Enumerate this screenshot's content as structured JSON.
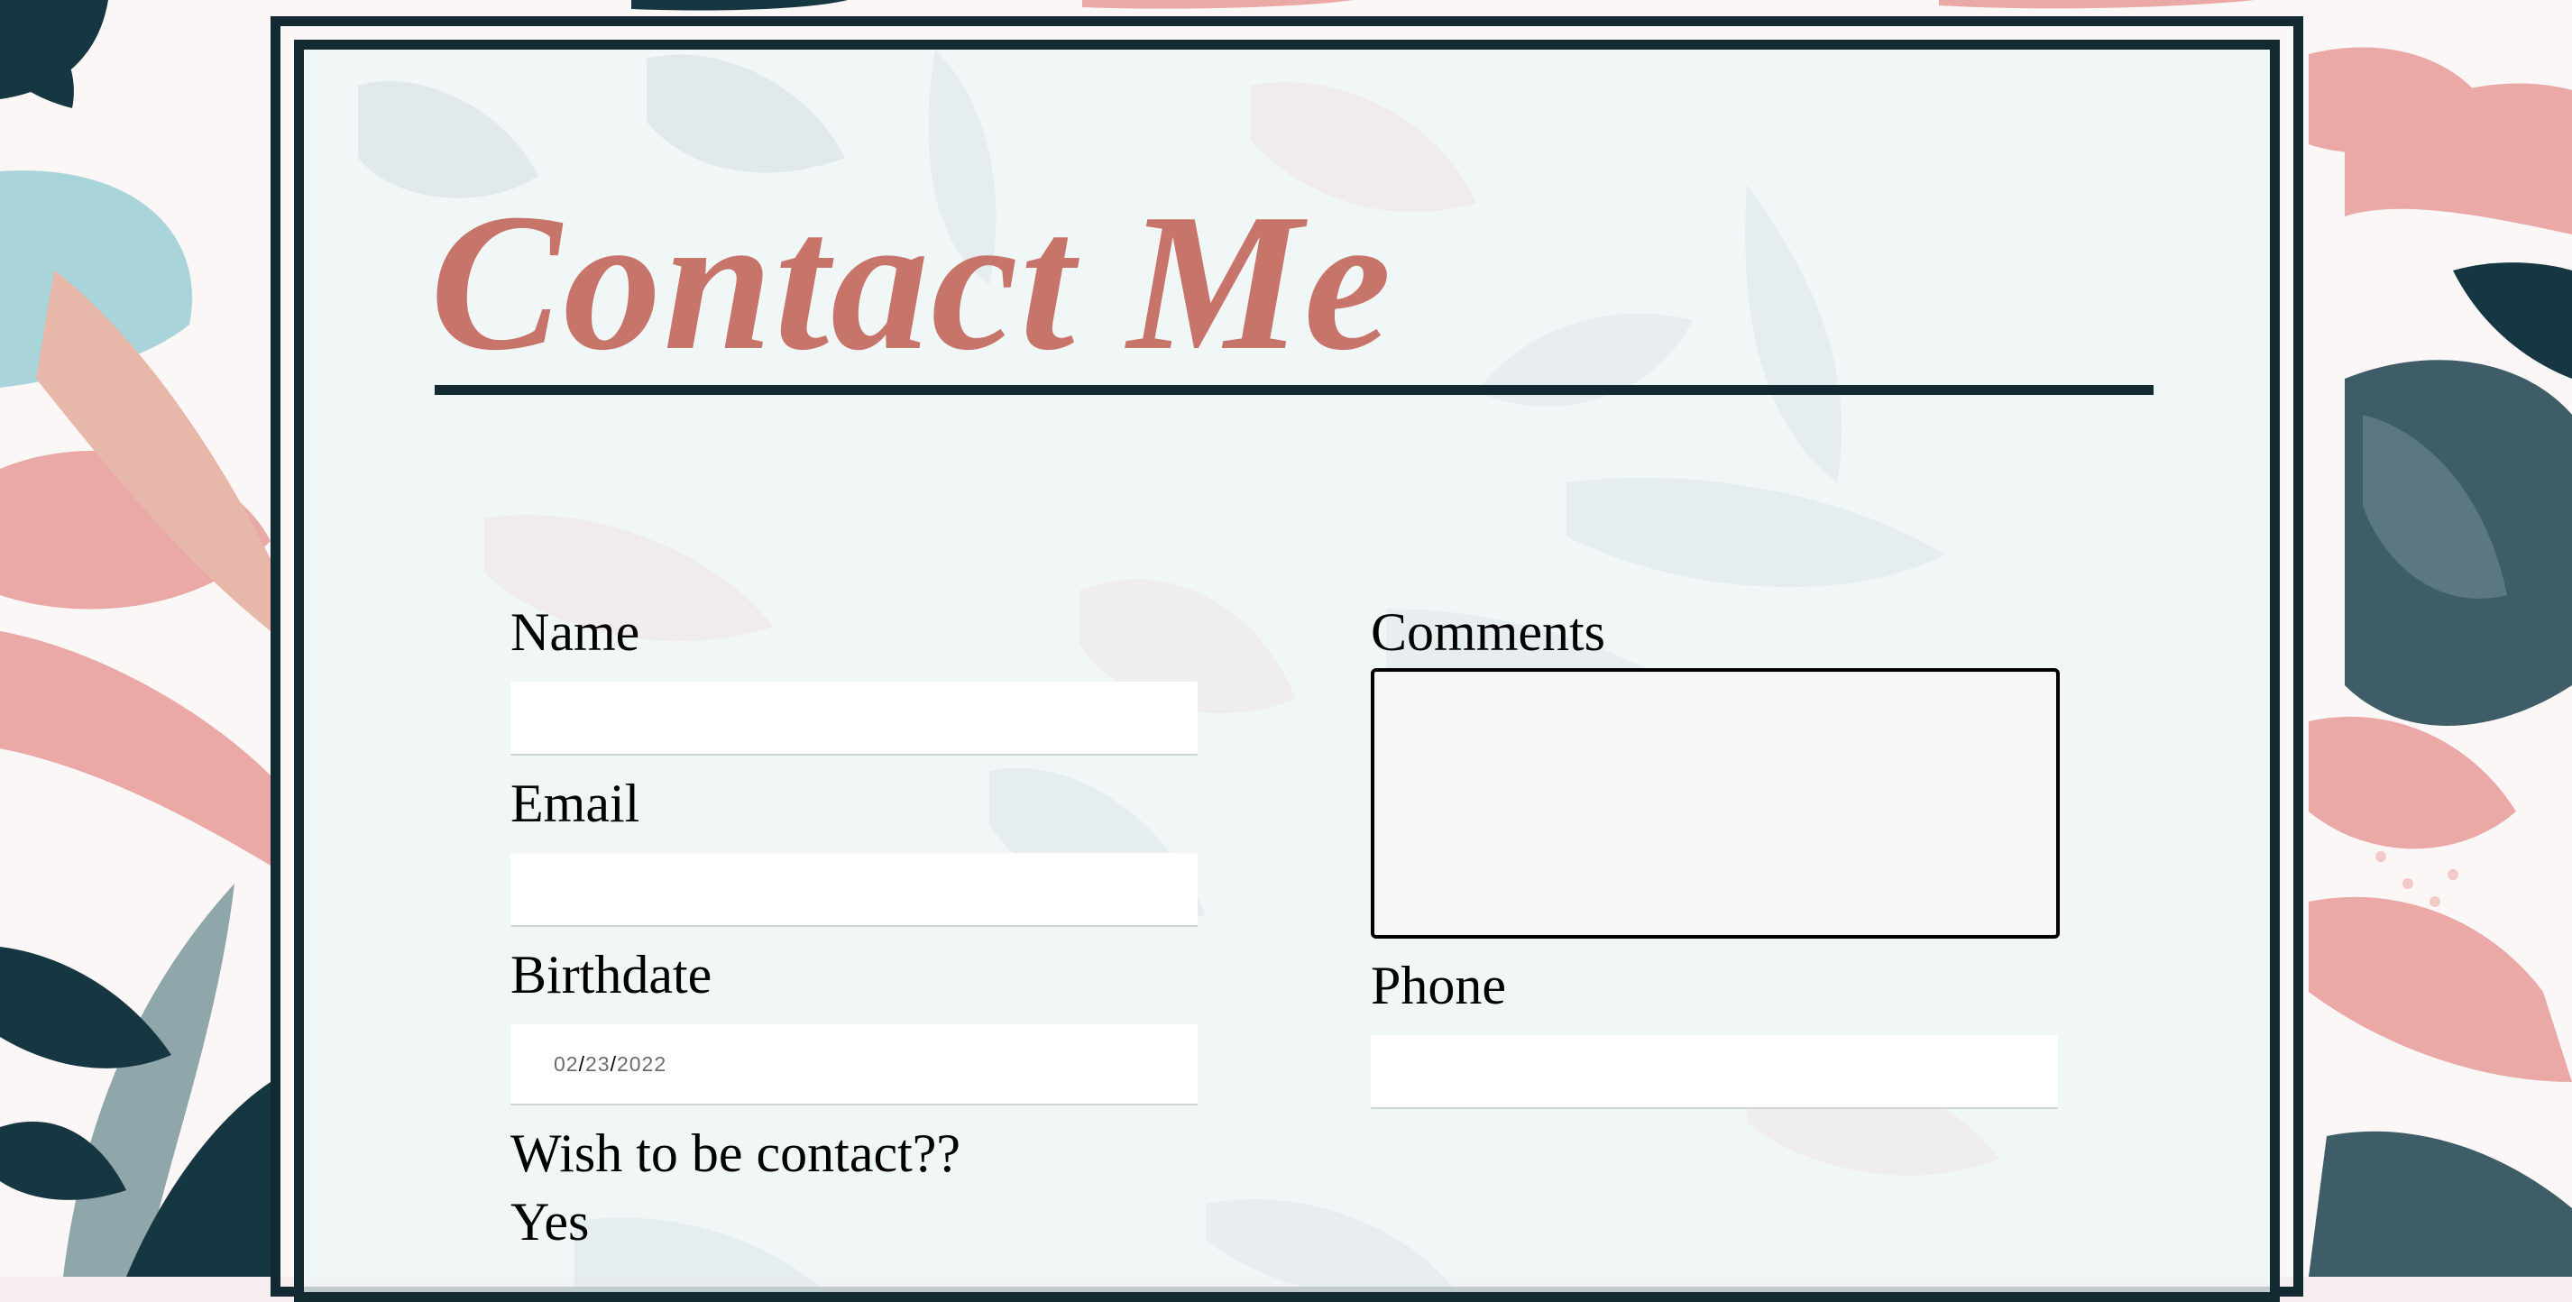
{
  "page": {
    "title": "Contact Me",
    "colors": {
      "title": "#c7756b",
      "frame": "#132a33",
      "background_pink": "#eaa9a7",
      "background_teal": "#a9d4d9",
      "background_navy": "#163642"
    }
  },
  "form": {
    "name": {
      "label": "Name",
      "value": ""
    },
    "email": {
      "label": "Email",
      "value": ""
    },
    "birthdate": {
      "label": "Birthdate",
      "month": "02",
      "day": "23",
      "year": "2022",
      "separator": "/"
    },
    "wish_contact": {
      "label": "Wish to be contact??",
      "option_yes": "Yes"
    },
    "comments": {
      "label": "Comments",
      "value": ""
    },
    "phone": {
      "label": "Phone",
      "value": ""
    }
  }
}
